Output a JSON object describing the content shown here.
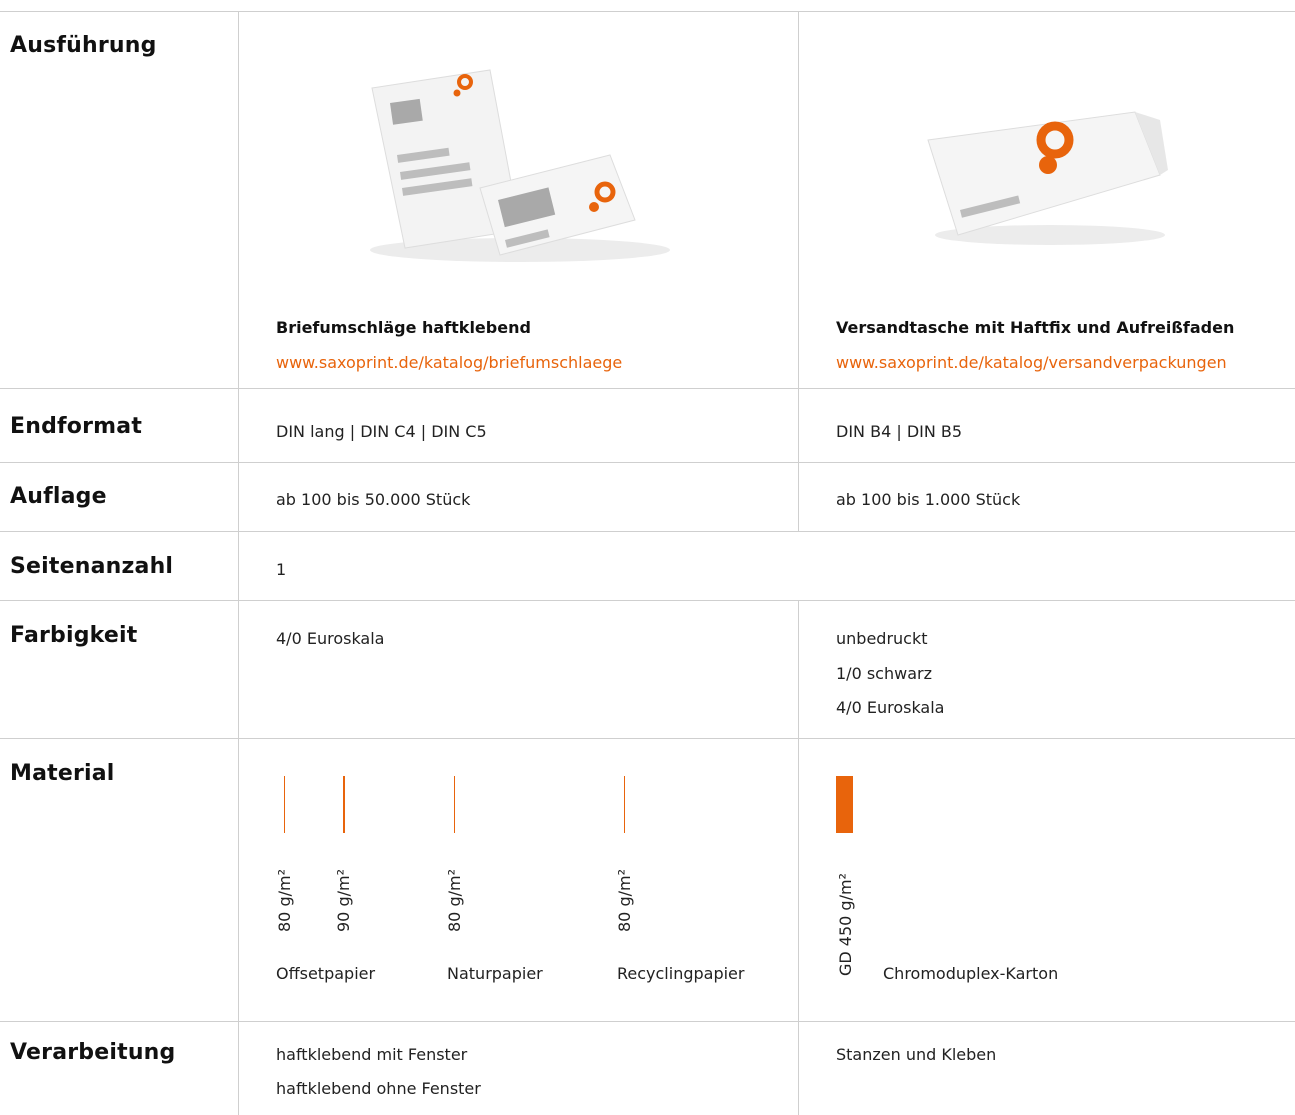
{
  "rows": {
    "ausfuehrung": "Ausführung",
    "endformat": "Endformat",
    "auflage": "Auflage",
    "seitenanzahl": "Seitenanzahl",
    "farbigkeit": "Farbigkeit",
    "material": "Material",
    "verarbeitung": "Verarbeitung"
  },
  "col1": {
    "product_name": "Briefumschläge haftklebend",
    "product_link": "www.saxoprint.de/katalog/briefumschlaege",
    "endformat": "DIN lang | DIN C4 | DIN C5",
    "auflage": "ab 100 bis 50.000 Stück",
    "seitenanzahl": "1",
    "farbigkeit": "4/0 Euroskala",
    "materials": {
      "offset_80": "80 g/m²",
      "offset_90": "90 g/m²",
      "natur_80": "80 g/m²",
      "recycling_80": "80 g/m²",
      "offset_label": "Offsetpapier",
      "natur_label": "Naturpapier",
      "recycling_label": "Recyclingpapier"
    },
    "verarbeitung": [
      "haftklebend mit Fenster",
      "haftklebend ohne Fenster"
    ]
  },
  "col2": {
    "product_name": "Versandtasche mit Haftfix und Aufreißfaden",
    "product_link": "www.saxoprint.de/katalog/versandverpackungen",
    "endformat": "DIN B4 | DIN B5",
    "auflage": "ab 100 bis 1.000 Stück",
    "farbigkeit": [
      "unbedruckt",
      "1/0 schwarz",
      "4/0 Euroskala"
    ],
    "materials": {
      "gd_450": "GD 450 g/m²",
      "chromo_label": "Chromoduplex-Karton"
    },
    "verarbeitung": "Stanzen und Kleben"
  },
  "colors": {
    "accent": "#e8640c",
    "rule": "#cfcfcf"
  },
  "icons": {
    "brand": "saxoprint-logo-icon"
  }
}
